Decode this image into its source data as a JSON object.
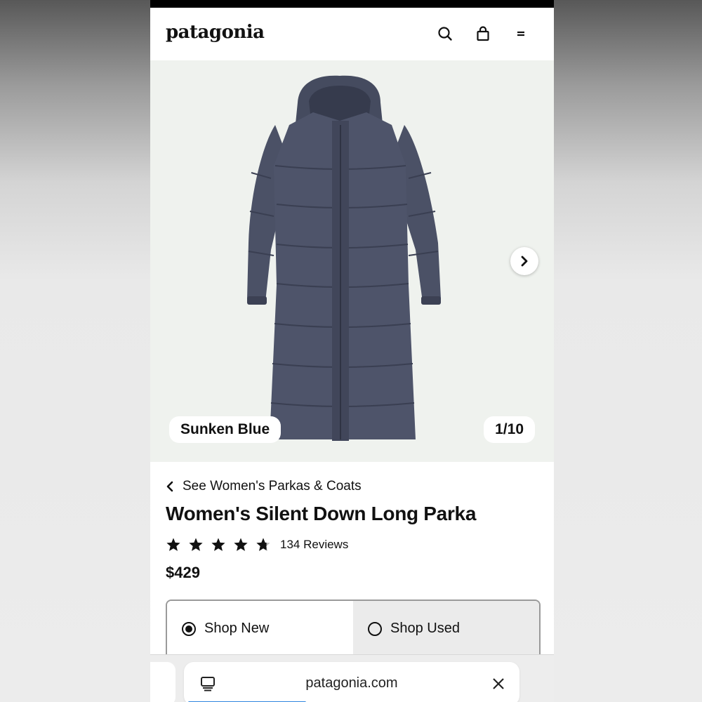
{
  "header": {
    "logo": "patagonia",
    "icons": [
      "search-icon",
      "shopping-bag-icon",
      "menu-icon"
    ]
  },
  "gallery": {
    "color_name": "Sunken Blue",
    "counter": "1/10",
    "next_icon": "chevron-right-icon",
    "product_color": "#4b5166"
  },
  "product": {
    "breadcrumb": "See Women's Parkas & Coats",
    "title": "Women's Silent Down Long Parka",
    "rating": 4.7,
    "reviews": "134 Reviews",
    "price": "$429"
  },
  "shop_toggle": {
    "options": [
      {
        "label": "Shop New",
        "selected": true
      },
      {
        "label": "Shop Used",
        "selected": false
      }
    ]
  },
  "browser": {
    "url": "patagonia.com",
    "load_progress": 0.35
  }
}
